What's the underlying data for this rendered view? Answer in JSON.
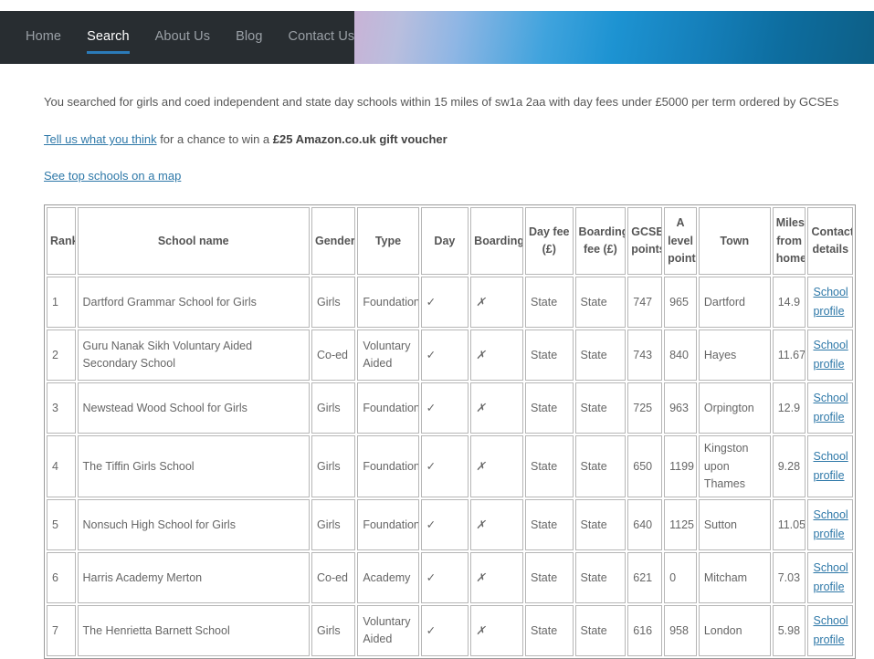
{
  "nav": {
    "items": [
      {
        "label": "Home",
        "active": false
      },
      {
        "label": "Search",
        "active": true
      },
      {
        "label": "About Us",
        "active": false
      },
      {
        "label": "Blog",
        "active": false
      },
      {
        "label": "Contact Us",
        "active": false
      }
    ],
    "bar_color": "#282d31",
    "active_underline_color": "#2b7bb9",
    "inactive_text_color": "#9aa0a6"
  },
  "intro": {
    "search_description": "You searched for girls and coed independent and state day schools within 15 miles of sw1a 2aa with day fees under £5000 per term ordered by GCSEs",
    "feedback_link": "Tell us what you think",
    "feedback_middle": " for a chance to win a ",
    "feedback_bold": "£25 Amazon.co.uk gift voucher",
    "map_link": "See top schools on a map",
    "link_color": "#2e78a8"
  },
  "table": {
    "headers": [
      "Rank",
      "School name",
      "Gender",
      "Type",
      "Day",
      "Boarding",
      "Day fee (£)",
      "Boarding fee (£)",
      "GCSE points",
      "A level points",
      "Town",
      "Miles from home",
      "Contact details"
    ],
    "icons": {
      "day_yes": "✓",
      "boarding_no": "✗"
    },
    "contact_link_label": "School profile",
    "rows": [
      {
        "rank": "1",
        "name": "Dartford Grammar School for Girls",
        "gender": "Girls",
        "type": "Foundation",
        "day": "✓",
        "boarding": "✗",
        "day_fee": "State",
        "boarding_fee": "State",
        "gcse_points": "747",
        "a_level_points": "965",
        "town": "Dartford",
        "miles": "14.9",
        "contact": "School profile"
      },
      {
        "rank": "2",
        "name": "Guru Nanak Sikh Voluntary Aided Secondary School",
        "gender": "Co-ed",
        "type": "Voluntary Aided",
        "day": "✓",
        "boarding": "✗",
        "day_fee": "State",
        "boarding_fee": "State",
        "gcse_points": "743",
        "a_level_points": "840",
        "town": "Hayes",
        "miles": "11.67",
        "contact": "School profile"
      },
      {
        "rank": "3",
        "name": "Newstead Wood School for Girls",
        "gender": "Girls",
        "type": "Foundation",
        "day": "✓",
        "boarding": "✗",
        "day_fee": "State",
        "boarding_fee": "State",
        "gcse_points": "725",
        "a_level_points": "963",
        "town": "Orpington",
        "miles": "12.9",
        "contact": "School profile"
      },
      {
        "rank": "4",
        "name": "The Tiffin Girls School",
        "gender": "Girls",
        "type": "Foundation",
        "day": "✓",
        "boarding": "✗",
        "day_fee": "State",
        "boarding_fee": "State",
        "gcse_points": "650",
        "a_level_points": "1199",
        "town": "Kingston upon Thames",
        "miles": "9.28",
        "contact": "School profile"
      },
      {
        "rank": "5",
        "name": "Nonsuch High School for Girls",
        "gender": "Girls",
        "type": "Foundation",
        "day": "✓",
        "boarding": "✗",
        "day_fee": "State",
        "boarding_fee": "State",
        "gcse_points": "640",
        "a_level_points": "1125",
        "town": "Sutton",
        "miles": "11.05",
        "contact": "School profile"
      },
      {
        "rank": "6",
        "name": "Harris Academy Merton",
        "gender": "Co-ed",
        "type": "Academy",
        "day": "✓",
        "boarding": "✗",
        "day_fee": "State",
        "boarding_fee": "State",
        "gcse_points": "621",
        "a_level_points": "0",
        "town": "Mitcham",
        "miles": "7.03",
        "contact": "School profile"
      },
      {
        "rank": "7",
        "name": "The Henrietta Barnett School",
        "gender": "Girls",
        "type": "Voluntary Aided",
        "day": "✓",
        "boarding": "✗",
        "day_fee": "State",
        "boarding_fee": "State",
        "gcse_points": "616",
        "a_level_points": "958",
        "town": "London",
        "miles": "5.98",
        "contact": "School profile"
      }
    ]
  }
}
